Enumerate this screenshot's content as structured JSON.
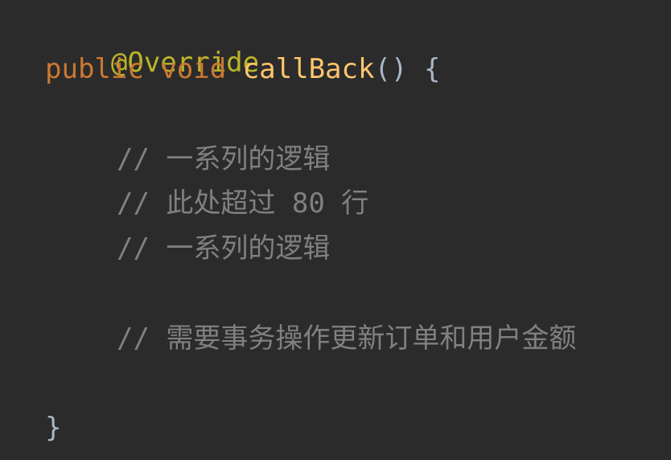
{
  "code": {
    "annotation": "@Override",
    "kw_public": "public",
    "kw_void": "void",
    "method_name": "callBack",
    "signature_tail": "() {",
    "comment_1": "// 一系列的逻辑",
    "comment_2": "// 此处超过 80 行",
    "comment_3": "// 一系列的逻辑",
    "comment_4": "// 需要事务操作更新订单和用户金额",
    "closing_brace": "}"
  },
  "colors": {
    "background": "#2b2b2b",
    "annotation": "#bbb529",
    "keyword": "#cc7832",
    "method": "#ffc66d",
    "plain": "#a9b7c6",
    "comment": "#808080"
  }
}
